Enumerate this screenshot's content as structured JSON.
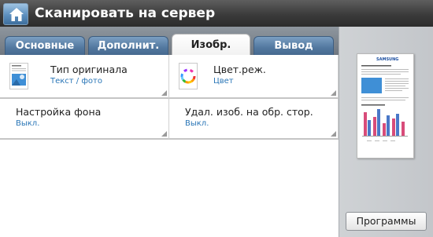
{
  "header": {
    "title": "Сканировать на сервер",
    "home_icon": "home-icon"
  },
  "tabs": [
    {
      "label": "Основные",
      "active": false
    },
    {
      "label": "Дополнит.",
      "active": false
    },
    {
      "label": "Изобр.",
      "active": true
    },
    {
      "label": "Вывод",
      "active": false
    }
  ],
  "settings": [
    {
      "label": "Тип оригинала",
      "value": "Текст / фото",
      "icon": "original-type-icon"
    },
    {
      "label": "Цвет.реж.",
      "value": "Цвет",
      "icon": "color-mode-icon"
    },
    {
      "label": "Настройка фона",
      "value": "Выкл."
    },
    {
      "label": "Удал. изоб. на обр. стор.",
      "value": "Выкл."
    }
  ],
  "side_panel": {
    "preview_icon": "document-preview-icon",
    "programs_label": "Программы",
    "preview_brand": "SAMSUNG"
  },
  "colors": {
    "header": "#3b3b3b",
    "tab": "#52789f",
    "value_text": "#2a76b7",
    "side_panel": "#c9ccd0"
  }
}
